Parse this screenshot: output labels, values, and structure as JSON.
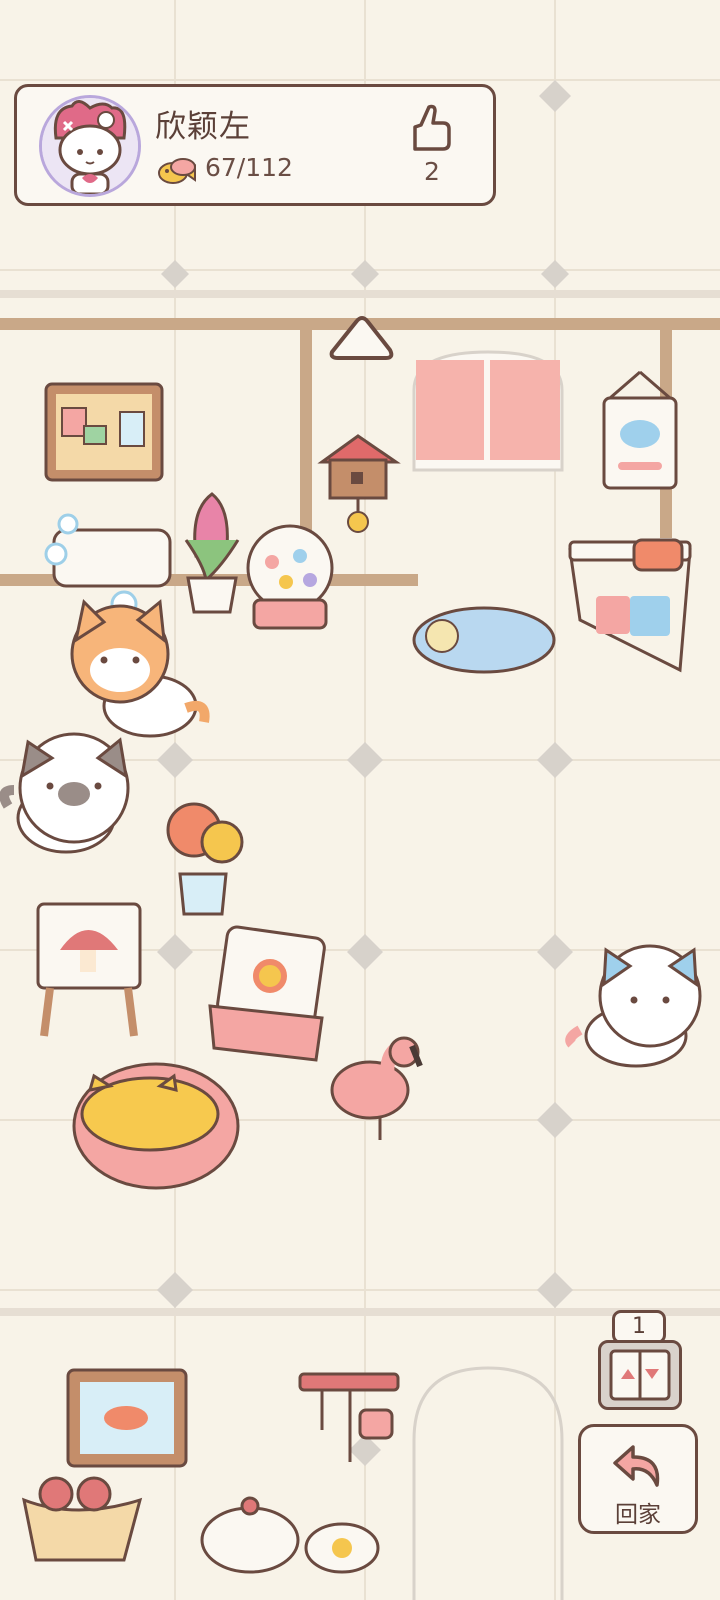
{
  "player": {
    "name": "欣颖左",
    "fish_count": "67/112",
    "likes": "2"
  },
  "elevator": {
    "floor": "1"
  },
  "buttons": {
    "home_label": "回家"
  },
  "colors": {
    "floor": "#f8f3e8",
    "outline": "#6a4a40",
    "wall": "#c9a888",
    "accent_pink": "#f4a6a3"
  },
  "icons": [
    "thumbs-up-icon",
    "fish-currency-icon",
    "return-arrow-icon",
    "up-arrow-icon",
    "elevator-icon"
  ]
}
